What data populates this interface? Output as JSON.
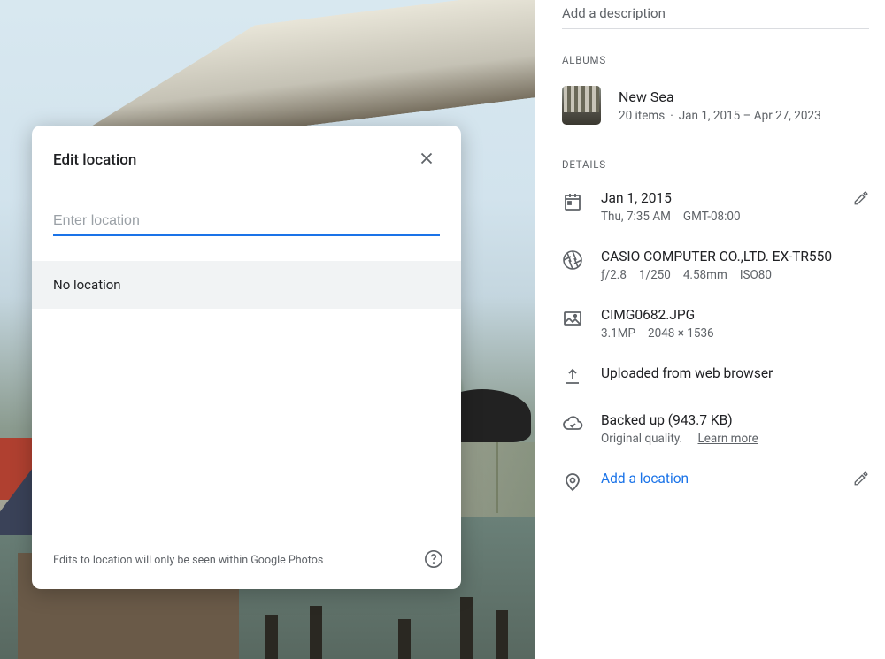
{
  "modal": {
    "title": "Edit location",
    "placeholder": "Enter location",
    "no_location_label": "No location",
    "footer_note": "Edits to location will only be seen within Google Photos"
  },
  "info": {
    "description_placeholder": "Add a description",
    "albums_label": "ALBUMS",
    "album": {
      "name": "New Sea",
      "items": "20 items",
      "range": "Jan 1, 2015 – Apr 27, 2023"
    },
    "details_label": "DETAILS",
    "date": {
      "primary": "Jan 1, 2015",
      "day_time": "Thu, 7:35 AM",
      "tz": "GMT-08:00"
    },
    "camera": {
      "name": "CASIO COMPUTER CO.,LTD. EX-TR550",
      "aperture": "ƒ/2.8",
      "shutter": "1/250",
      "focal": "4.58mm",
      "iso": "ISO80"
    },
    "file": {
      "name": "CIMG0682.JPG",
      "mp": "3.1MP",
      "dims": "2048 × 1536"
    },
    "upload": {
      "label": "Uploaded from web browser"
    },
    "backup": {
      "label": "Backed up (943.7 KB)",
      "quality": "Original quality.",
      "learn_more": "Learn more"
    },
    "location": {
      "add_label": "Add a location"
    }
  }
}
